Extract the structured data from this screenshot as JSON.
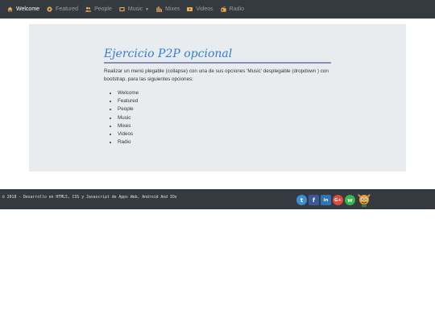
{
  "navbar": {
    "items": [
      {
        "label": "Welcome",
        "icon": "home-icon"
      },
      {
        "label": "Featured",
        "icon": "featured-icon"
      },
      {
        "label": "People",
        "icon": "people-icon"
      },
      {
        "label": "Music",
        "icon": "music-icon"
      },
      {
        "label": "Mixes",
        "icon": "mixes-icon"
      },
      {
        "label": "Videos",
        "icon": "video-icon"
      },
      {
        "label": "Radio",
        "icon": "radio-icon"
      }
    ],
    "icon_color": "#f0ad4e"
  },
  "main": {
    "title": "Ejercicio P2P opcional",
    "description": "Realizar un menú plegable (collapse) con una de sus opciones 'Music' desplegable (dropdown ) con bootstrap, para las siguientes opciones:",
    "options": [
      "Welcome",
      "Featured",
      "People",
      "Music",
      "Mixes",
      "Videos",
      "Radio"
    ]
  },
  "footer": {
    "copyright": "© 2018 - Desarrollo en HTML5, CSS y Javascript de Apps Web, Android And IOs",
    "social": [
      {
        "name": "twitter-icon",
        "glyph": "t",
        "color": "#3b8fd6"
      },
      {
        "name": "facebook-icon",
        "glyph": "f",
        "color": "#3b5998"
      },
      {
        "name": "linkedin-icon",
        "glyph": "in",
        "color": "#2f74b5"
      },
      {
        "name": "google-plus-icon",
        "glyph": "G+",
        "color": "#dd4b39"
      },
      {
        "name": "whatsapp-icon",
        "glyph": "w",
        "color": "#34b84a"
      }
    ]
  }
}
